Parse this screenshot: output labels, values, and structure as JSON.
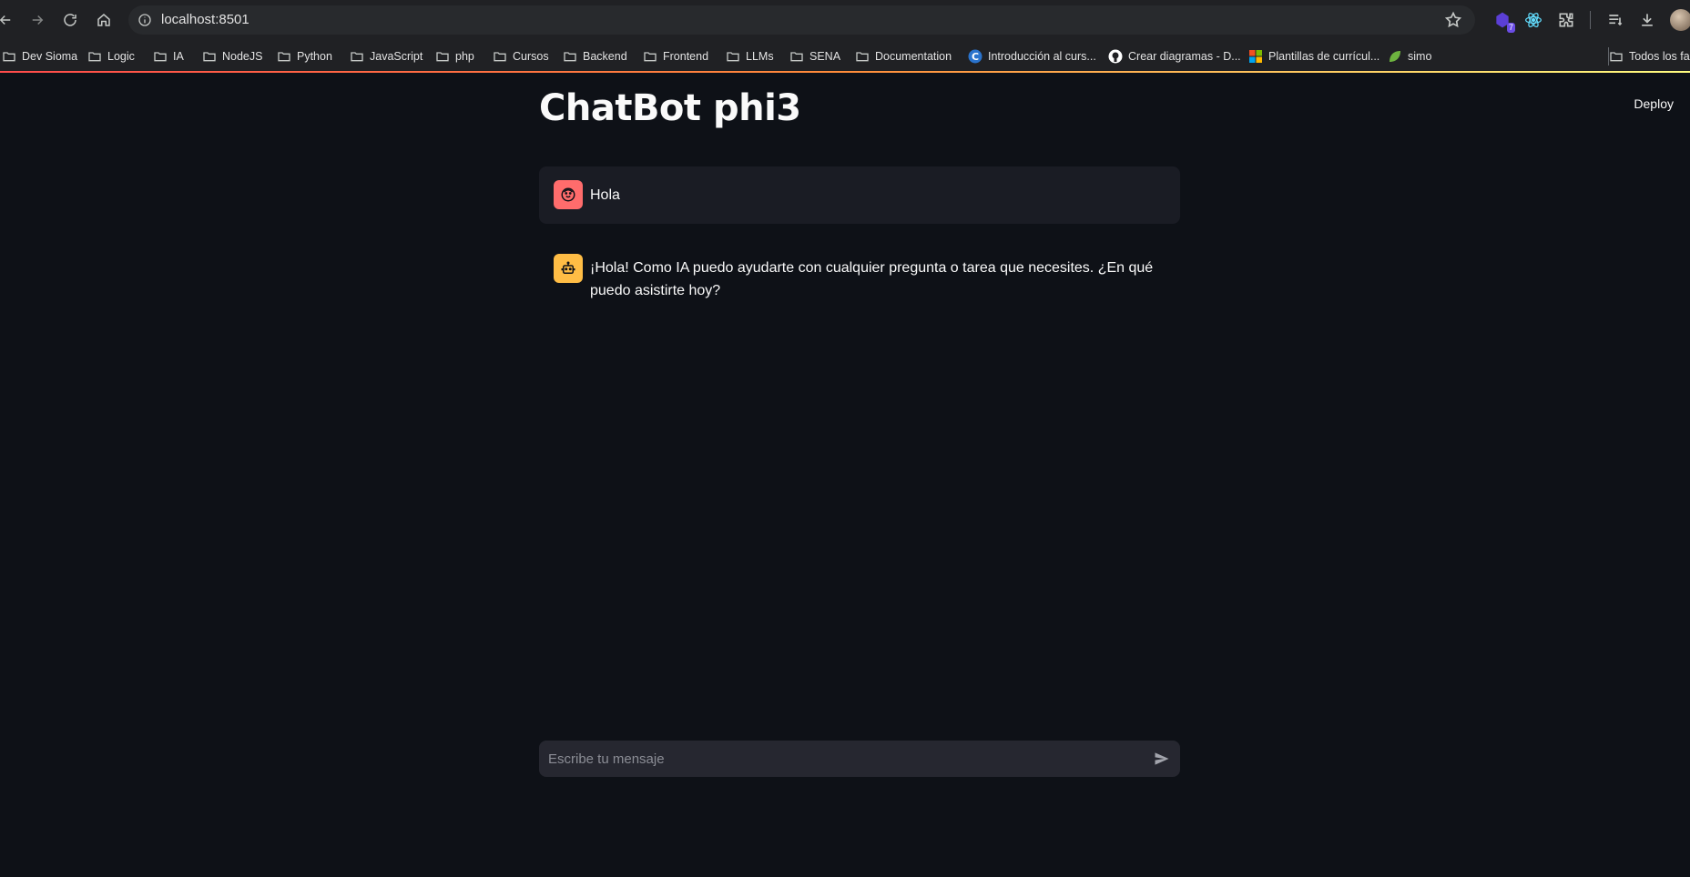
{
  "browser": {
    "url": "localhost:8501",
    "bookmarks": [
      {
        "label": "Dev Sioma",
        "icon": "folder-icon"
      },
      {
        "label": "Logic",
        "icon": "folder-icon"
      },
      {
        "label": "IA",
        "icon": "folder-icon"
      },
      {
        "label": "NodeJS",
        "icon": "folder-icon"
      },
      {
        "label": "Python",
        "icon": "folder-icon"
      },
      {
        "label": "JavaScript",
        "icon": "folder-icon"
      },
      {
        "label": "php",
        "icon": "folder-icon"
      },
      {
        "label": "Cursos",
        "icon": "folder-icon"
      },
      {
        "label": "Backend",
        "icon": "folder-icon"
      },
      {
        "label": "Frontend",
        "icon": "folder-icon"
      },
      {
        "label": "LLMs",
        "icon": "folder-icon"
      },
      {
        "label": "SENA",
        "icon": "folder-icon"
      },
      {
        "label": "Documentation",
        "icon": "folder-icon"
      },
      {
        "label": "Introducción al curs...",
        "icon": "coursera-icon"
      },
      {
        "label": "Crear diagramas - D...",
        "icon": "github-icon"
      },
      {
        "label": "Plantillas de currícul...",
        "icon": "microsoft-icon"
      },
      {
        "label": "simo",
        "icon": "leaf-icon"
      }
    ],
    "other_bookmarks": "Todos los fa",
    "extension_badge": "7"
  },
  "app": {
    "deploy_label": "Deploy",
    "title": "ChatBot phi3",
    "messages": [
      {
        "role": "user",
        "avatar": "user-face-icon",
        "text": "Hola"
      },
      {
        "role": "assistant",
        "avatar": "robot-icon",
        "text": "¡Hola! Como IA puedo ayudarte con cualquier pregunta o tarea que necesites. ¿En qué puedo asistirte hoy?"
      }
    ],
    "input": {
      "placeholder": "Escribe tu mensaje",
      "value": ""
    }
  },
  "colors": {
    "background": "#0e1117",
    "user_bubble": "#1a1c24",
    "user_avatar": "#ff6c6c",
    "bot_avatar": "#ffbd45",
    "input_bg": "#262730"
  }
}
